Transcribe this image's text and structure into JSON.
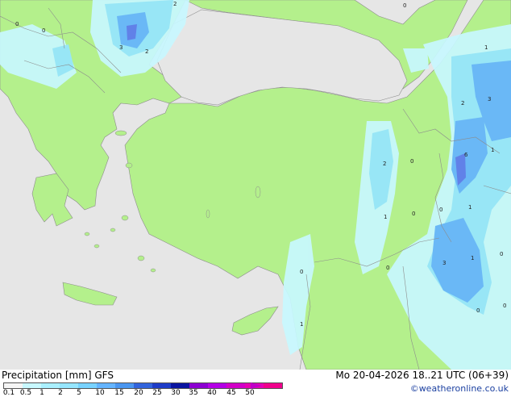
{
  "map": {
    "colors": {
      "sea": "#e6e6e6",
      "land": "#b4f08c",
      "precip_light": "#c8f8ff",
      "precip_mid": "#96e6ff",
      "precip_high": "#64b4ff",
      "precip_core": "#5a78f0",
      "border": "#8c8c8c"
    },
    "contour_values": [
      "0",
      "3",
      "2",
      "2",
      "0",
      "0",
      "1",
      "2",
      "3",
      "1",
      "0",
      "2",
      "6",
      "0",
      "1",
      "1",
      "0",
      "1",
      "3",
      "0",
      "0",
      "0",
      "0",
      "0",
      "1"
    ]
  },
  "footer": {
    "title": "Precipitation [mm]  GFS",
    "datetime": "Mo 20-04-2026 18..21 UTC (06+39)",
    "credit": "©weatheronline.co.uk",
    "scale_colors": [
      "#f5f5f5",
      "#c8f8ff",
      "#aaf0ff",
      "#96e6ff",
      "#78d2ff",
      "#64b4ff",
      "#4a96f0",
      "#3264dc",
      "#1e3cc8",
      "#0a14a0",
      "#8c00d2",
      "#b400e6",
      "#d200c8",
      "#e600b4",
      "#f0008c"
    ],
    "scale_ticks": [
      "0.1",
      "0.5",
      "1",
      "2",
      "5",
      "10",
      "15",
      "20",
      "25",
      "30",
      "35",
      "40",
      "45",
      "50"
    ]
  }
}
